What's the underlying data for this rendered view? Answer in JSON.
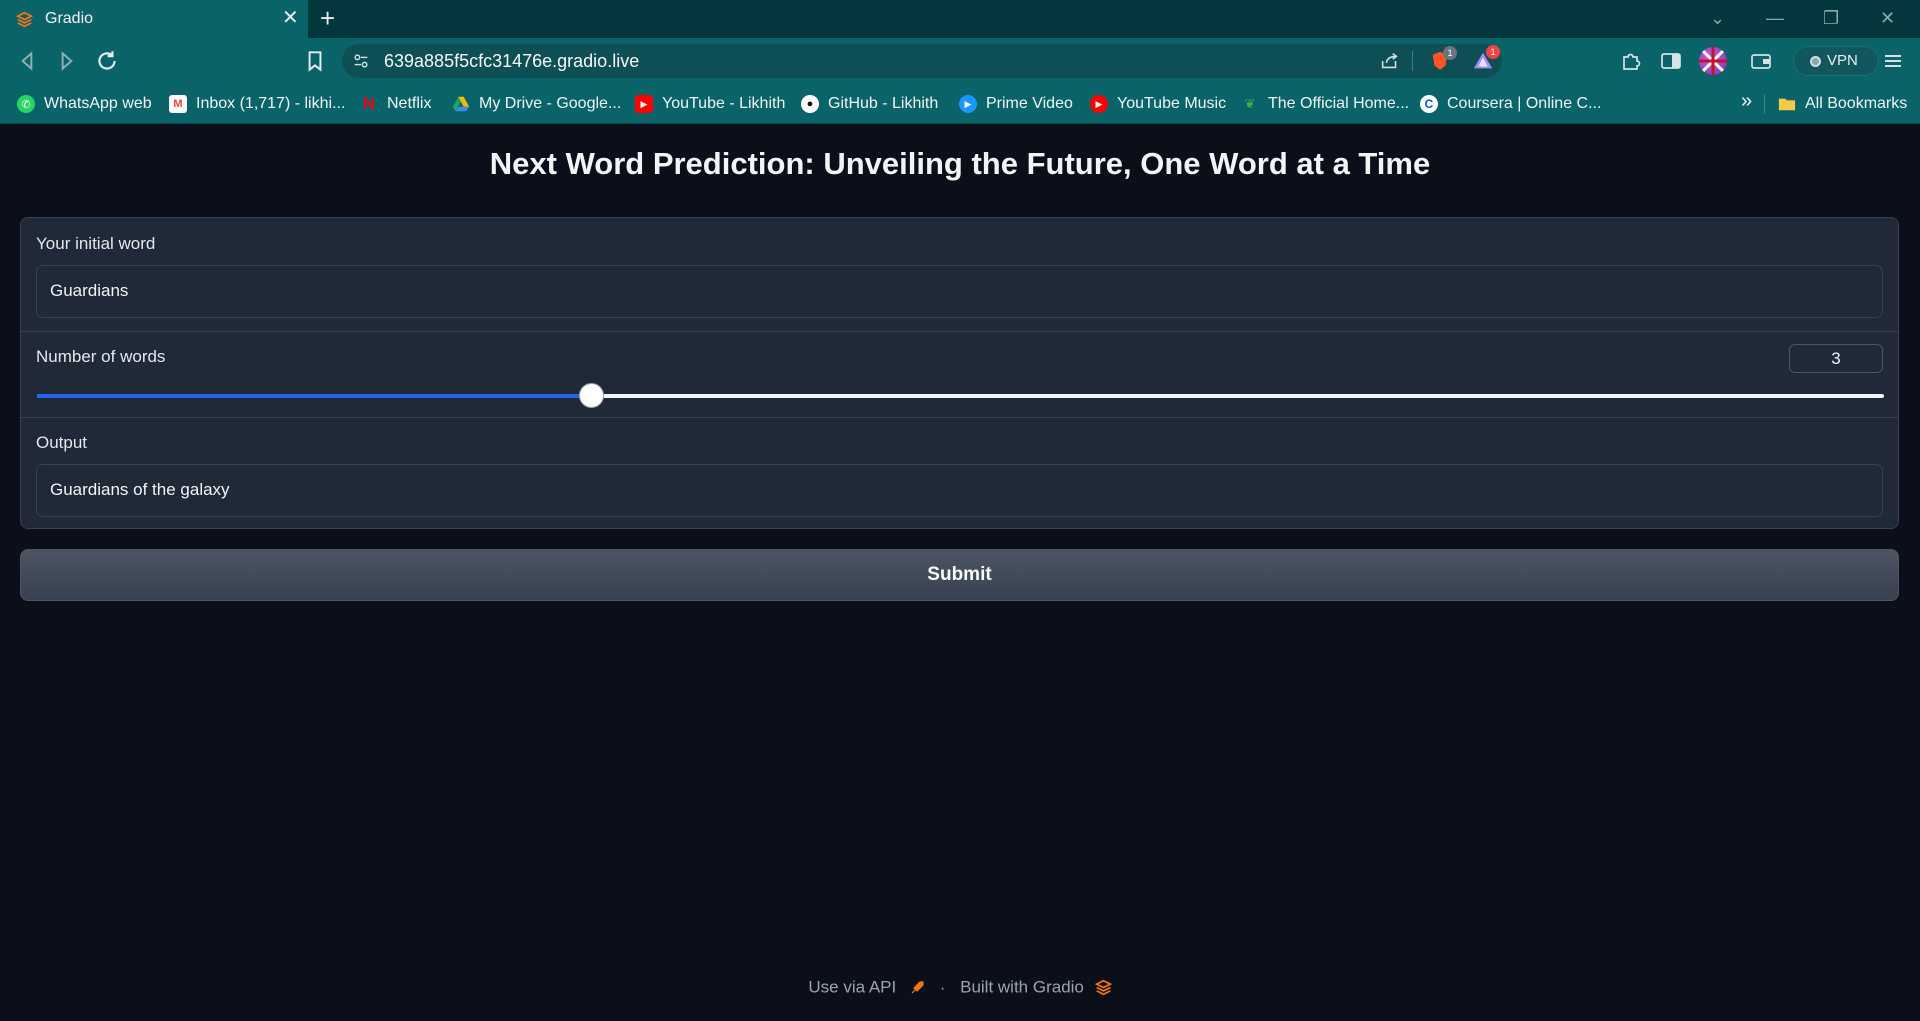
{
  "browser": {
    "tab_title": "Gradio",
    "tab_close": "✕",
    "new_tab": "+",
    "url": "639a885f5cfc31476e.gradio.live",
    "brave_badge": "1",
    "rewards_badge": "1",
    "vpn_label": "VPN",
    "window_controls": {
      "minimize": "—",
      "restore": "❐",
      "close": "✕",
      "tab_search": "⌄"
    },
    "bookmarks": [
      {
        "label": "WhatsApp web",
        "icon": "whatsapp-icon",
        "color": "#25d366"
      },
      {
        "label": "Inbox (1,717) - likhi...",
        "icon": "gmail-icon",
        "color": "#ea4335"
      },
      {
        "label": "Netflix",
        "icon": "netflix-icon",
        "color": "#e50914"
      },
      {
        "label": "My Drive - Google...",
        "icon": "google-drive-icon",
        "color": "#1fa463"
      },
      {
        "label": "YouTube - Likhith",
        "icon": "youtube-icon",
        "color": "#ff0000"
      },
      {
        "label": "GitHub - Likhith",
        "icon": "github-icon",
        "color": "#ffffff"
      },
      {
        "label": "Prime Video",
        "icon": "prime-video-icon",
        "color": "#1a98ff"
      },
      {
        "label": "YouTube Music",
        "icon": "youtube-music-icon",
        "color": "#ff0000"
      },
      {
        "label": "The Official Home...",
        "icon": "site-icon",
        "color": "#3fae49"
      },
      {
        "label": "Coursera | Online C...",
        "icon": "coursera-icon",
        "color": "#0056d2"
      }
    ],
    "bookmarks_more": "»",
    "all_bookmarks": "All Bookmarks"
  },
  "app": {
    "title": "Next Word Prediction: Unveiling the Future, One Word at a Time",
    "input": {
      "label": "Your initial word",
      "value": "Guardians"
    },
    "slider": {
      "label": "Number of words",
      "value": "3",
      "fraction": 0.3
    },
    "output": {
      "label": "Output",
      "value": "Guardians of the galaxy"
    },
    "submit_label": "Submit",
    "footer": {
      "api": "Use via API",
      "separator": "·",
      "built": "Built with Gradio"
    }
  },
  "colors": {
    "accent": "#2563eb",
    "page_bg": "#0b0f19",
    "panel_bg": "#1f2937",
    "chrome_bg": "#0a6368",
    "gradio_orange": "#f97316"
  }
}
